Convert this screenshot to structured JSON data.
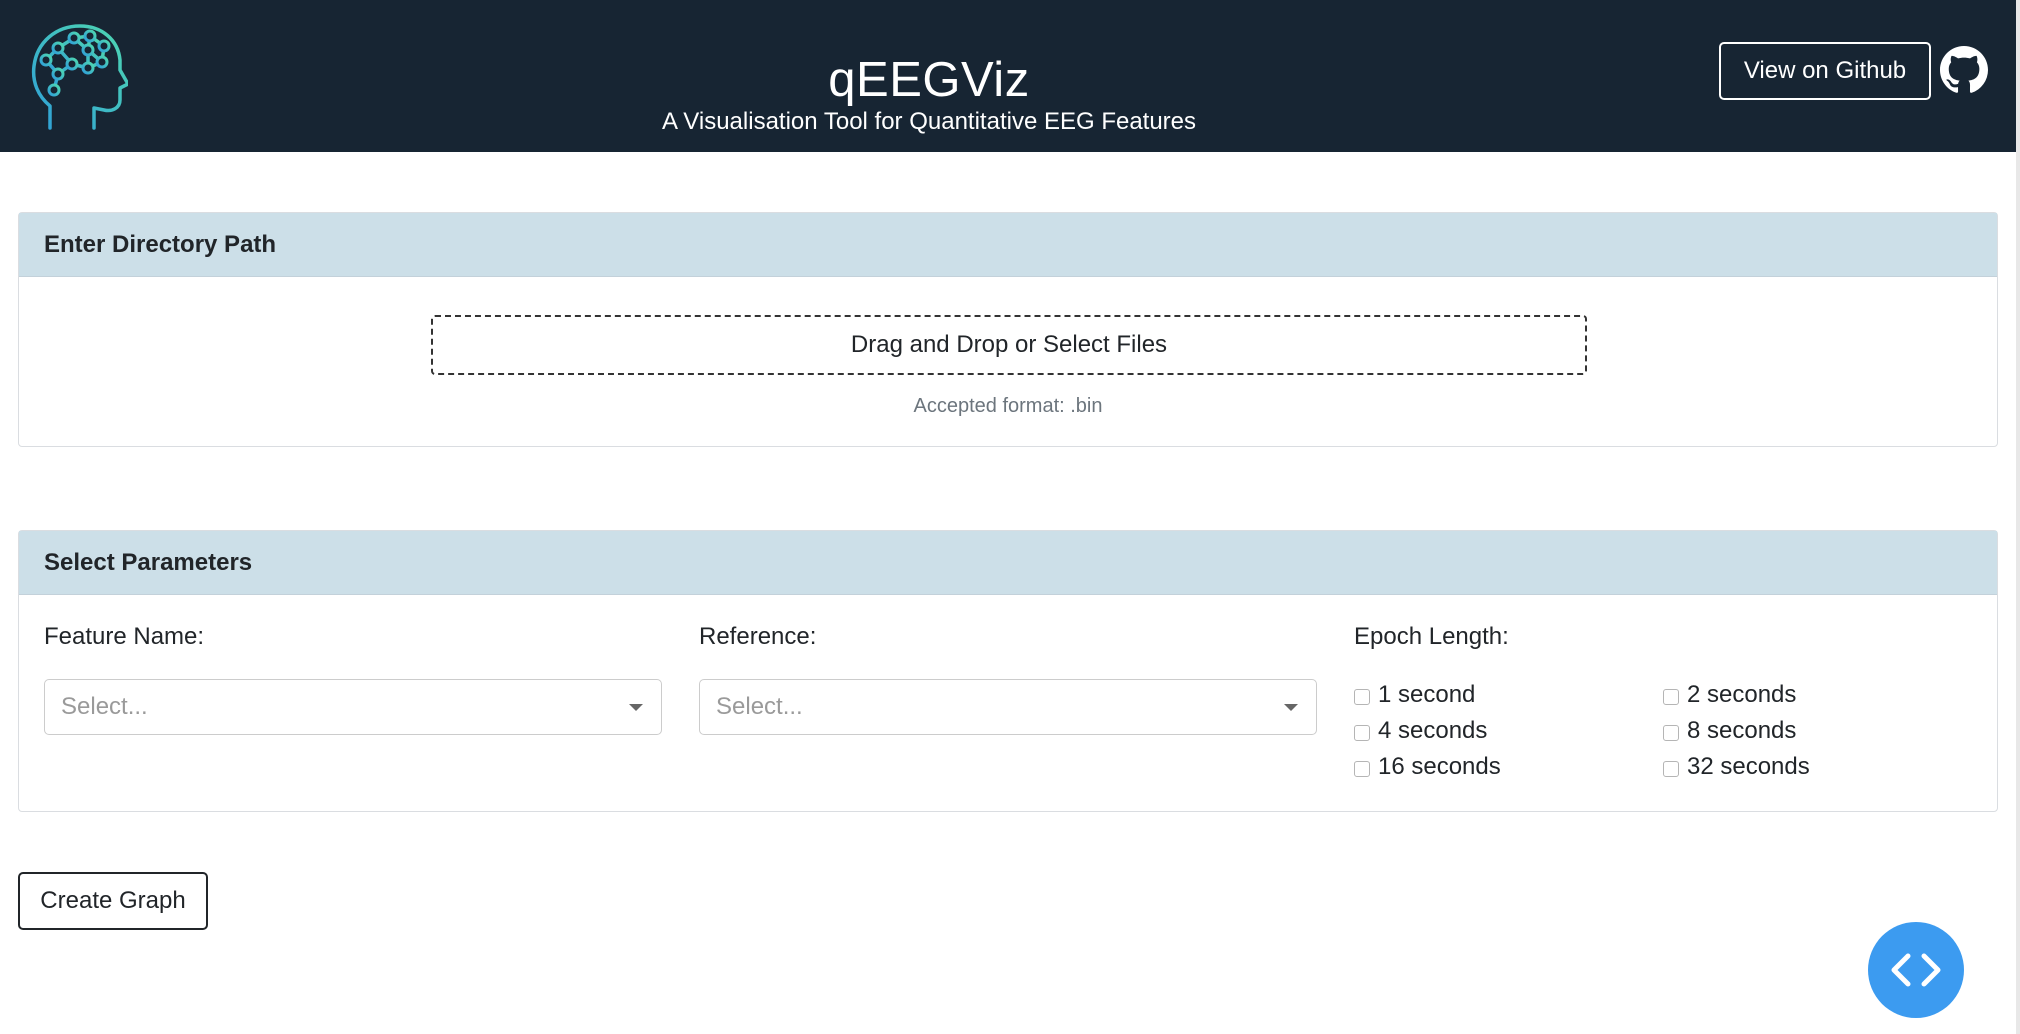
{
  "header": {
    "title": "qEEGViz",
    "subtitle": "A Visualisation Tool for Quantitative EEG Features",
    "github_button": "View on Github",
    "logo_icon": "brain-head-icon",
    "github_icon": "github-octocat-icon"
  },
  "directory": {
    "heading": "Enter Directory Path",
    "dropzone_label": "Drag and Drop or Select Files",
    "accepted_format": "Accepted format: .bin"
  },
  "parameters": {
    "heading": "Select Parameters",
    "feature": {
      "label": "Feature Name:",
      "placeholder": "Select..."
    },
    "reference": {
      "label": "Reference:",
      "placeholder": "Select..."
    },
    "epoch": {
      "label": "Epoch Length:",
      "options": [
        {
          "label": "1 second",
          "checked": false
        },
        {
          "label": "2 seconds",
          "checked": false
        },
        {
          "label": "4 seconds",
          "checked": false
        },
        {
          "label": "8 seconds",
          "checked": false
        },
        {
          "label": "16 seconds",
          "checked": false
        },
        {
          "label": "32 seconds",
          "checked": false
        }
      ]
    }
  },
  "actions": {
    "create_graph": "Create Graph",
    "fab_icon": "code-brackets-icon"
  },
  "colors": {
    "header_bg": "#172533",
    "card_header_bg": "#ccdfe8",
    "fab_bg": "#3c9bf0",
    "logo_gradient_start": "#2f9fd8",
    "logo_gradient_end": "#4fd8b0"
  }
}
